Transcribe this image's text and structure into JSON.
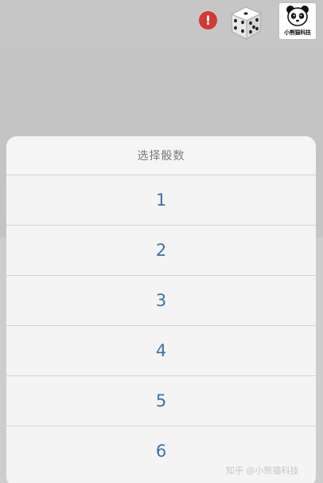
{
  "top_bar": {
    "alert_badge_text": "!",
    "dice_icon": "dice-icon",
    "brand_logo_text": "小熊猫科技"
  },
  "sheet": {
    "title": "选择骰数",
    "options": [
      "1",
      "2",
      "3",
      "4",
      "5",
      "6"
    ]
  },
  "watermark": "知乎 @小熊猫科技",
  "colors": {
    "backdrop": "#c4c4c4",
    "sheet_bg": "#f4f4f4",
    "option_text": "#3d72a4",
    "title_text": "#7a7a7a",
    "alert_red": "#d23a32"
  }
}
